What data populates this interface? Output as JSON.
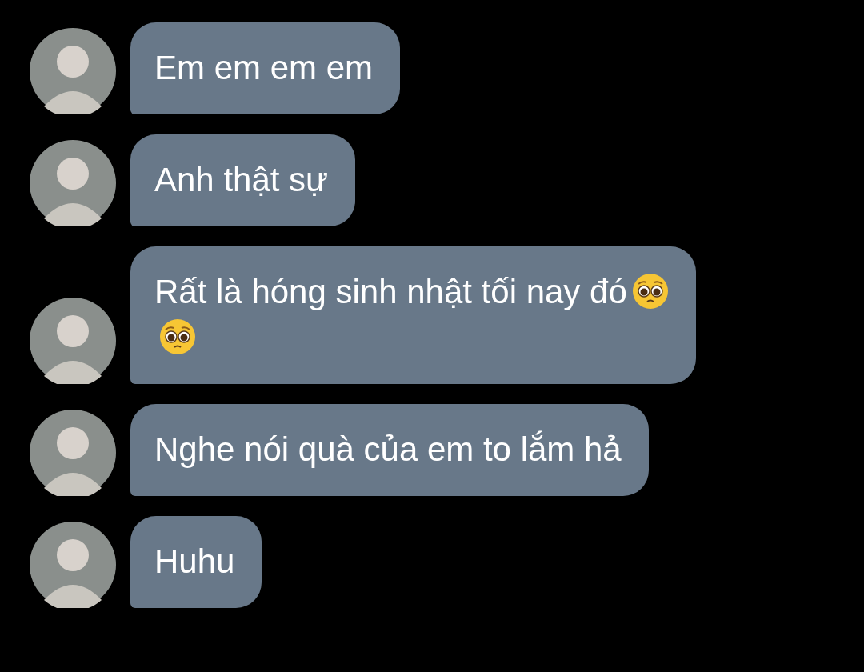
{
  "messages": [
    {
      "text": "Em em em em"
    },
    {
      "text": "Anh thật sự"
    },
    {
      "text": "Rất là hóng sinh nhật tối nay đó",
      "icons": [
        {
          "kind": "pleading-face"
        },
        {
          "kind": "pleading-face"
        }
      ]
    },
    {
      "text": "Nghe nói quà của em to lắm hả"
    },
    {
      "text": "Huhu"
    }
  ]
}
